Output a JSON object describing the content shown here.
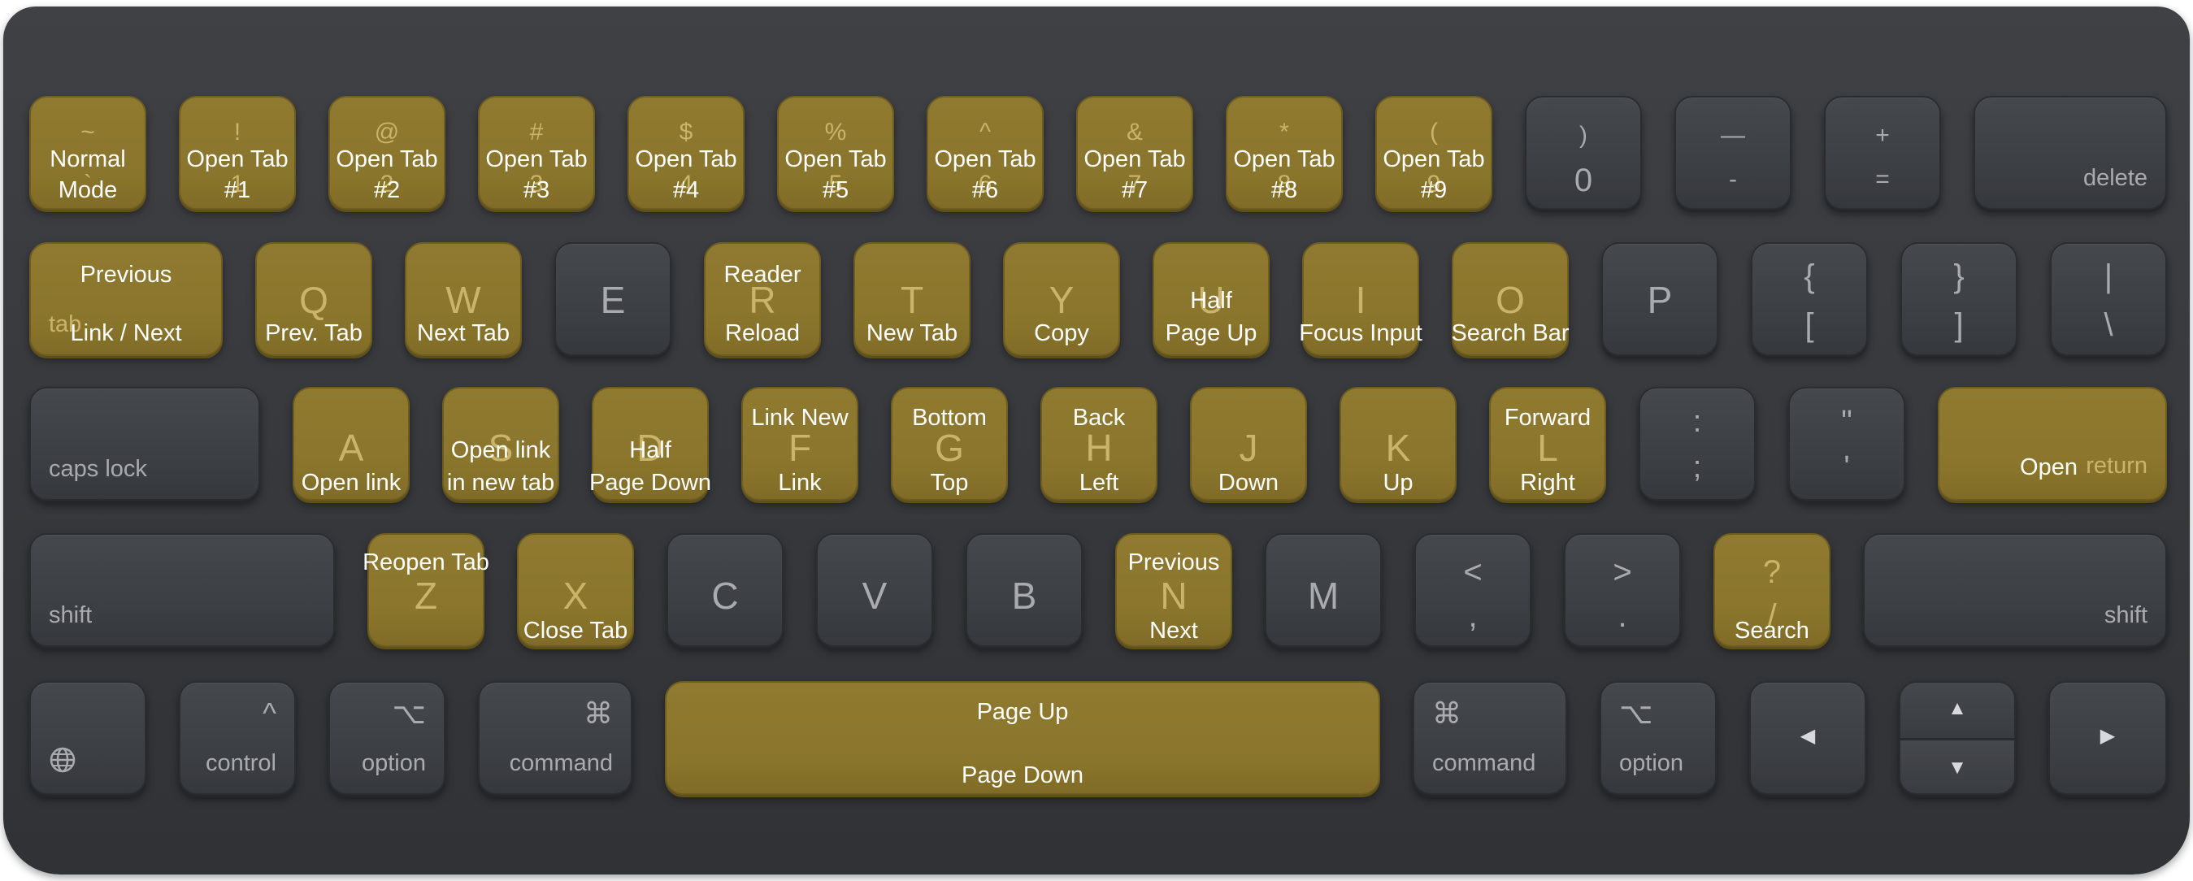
{
  "rows": {
    "numbers": [
      {
        "top": "~",
        "bottom": "`",
        "desc": [
          "Normal",
          "Mode"
        ],
        "hl": true
      },
      {
        "top": "!",
        "bottom": "1",
        "desc": [
          "Open Tab",
          "#1"
        ],
        "hl": true
      },
      {
        "top": "@",
        "bottom": "2",
        "desc": [
          "Open Tab",
          "#2"
        ],
        "hl": true
      },
      {
        "top": "#",
        "bottom": "3",
        "desc": [
          "Open Tab",
          "#3"
        ],
        "hl": true
      },
      {
        "top": "$",
        "bottom": "4",
        "desc": [
          "Open Tab",
          "#4"
        ],
        "hl": true
      },
      {
        "top": "%",
        "bottom": "5",
        "desc": [
          "Open Tab",
          "#5"
        ],
        "hl": true
      },
      {
        "top": "^",
        "bottom": "6",
        "desc": [
          "Open Tab",
          "#6"
        ],
        "hl": true
      },
      {
        "top": "&",
        "bottom": "7",
        "desc": [
          "Open Tab",
          "#7"
        ],
        "hl": true
      },
      {
        "top": "*",
        "bottom": "8",
        "desc": [
          "Open Tab",
          "#8"
        ],
        "hl": true
      },
      {
        "top": "(",
        "bottom": "9",
        "desc": [
          "Open Tab",
          "#9"
        ],
        "hl": true
      },
      {
        "top": ")",
        "bottom": "0",
        "desc": [],
        "hl": false
      },
      {
        "top": "—",
        "bottom": "-",
        "desc": [],
        "hl": false
      },
      {
        "top": "+",
        "bottom": "=",
        "desc": [],
        "hl": false
      },
      {
        "word": "delete",
        "desc": [],
        "hl": false
      }
    ],
    "qwerty": [
      {
        "word": "tab",
        "desc": [
          "Previous",
          "Link / Next"
        ],
        "hl": true
      },
      {
        "letter": "Q",
        "desc": [
          "Prev. Tab"
        ],
        "hl": true
      },
      {
        "letter": "W",
        "desc": [
          "Next Tab"
        ],
        "hl": true
      },
      {
        "letter": "E",
        "desc": [],
        "hl": false
      },
      {
        "letter": "R",
        "desc": [
          "Reader",
          "Reload"
        ],
        "hl": true
      },
      {
        "letter": "T",
        "desc": [
          "New Tab"
        ],
        "hl": true
      },
      {
        "letter": "Y",
        "desc": [
          "Copy"
        ],
        "hl": true
      },
      {
        "letter": "U",
        "desc": [
          "Half",
          "Page Up"
        ],
        "hl": true
      },
      {
        "letter": "I",
        "desc": [
          "Focus Input"
        ],
        "hl": true
      },
      {
        "letter": "O",
        "desc": [
          "Search Bar"
        ],
        "hl": true
      },
      {
        "letter": "P",
        "desc": [],
        "hl": false
      },
      {
        "top": "{",
        "bottom": "[",
        "desc": [],
        "hl": false
      },
      {
        "top": "}",
        "bottom": "]",
        "desc": [],
        "hl": false
      },
      {
        "top": "|",
        "bottom": "\\",
        "desc": [],
        "hl": false
      }
    ],
    "home": [
      {
        "word": "caps lock",
        "desc": [],
        "hl": false
      },
      {
        "letter": "A",
        "desc": [
          "Open link"
        ],
        "hl": true
      },
      {
        "letter": "S",
        "desc": [
          "Open link",
          "in new tab"
        ],
        "hl": true
      },
      {
        "letter": "D",
        "desc": [
          "Half",
          "Page Down"
        ],
        "hl": true
      },
      {
        "letter": "F",
        "desc": [
          "Link New",
          "Link"
        ],
        "hl": true
      },
      {
        "letter": "G",
        "desc": [
          "Bottom",
          "Top"
        ],
        "hl": true
      },
      {
        "letter": "H",
        "desc": [
          "Back",
          "Left"
        ],
        "hl": true
      },
      {
        "letter": "J",
        "desc": [
          "Down"
        ],
        "hl": true
      },
      {
        "letter": "K",
        "desc": [
          "Up"
        ],
        "hl": true
      },
      {
        "letter": "L",
        "desc": [
          "Forward",
          "Right"
        ],
        "hl": true
      },
      {
        "top": ":",
        "bottom": ";",
        "desc": [],
        "hl": false
      },
      {
        "top": "\"",
        "bottom": "'",
        "desc": [],
        "hl": false
      },
      {
        "word": "return",
        "desc": [
          "Open"
        ],
        "hl": true
      }
    ],
    "bottom": [
      {
        "word": "shift",
        "desc": [],
        "hl": false
      },
      {
        "letter": "Z",
        "desc": [
          "Reopen Tab"
        ],
        "hl": true
      },
      {
        "letter": "X",
        "desc": [
          "Close Tab"
        ],
        "hl": true
      },
      {
        "letter": "C",
        "desc": [],
        "hl": false
      },
      {
        "letter": "V",
        "desc": [],
        "hl": false
      },
      {
        "letter": "B",
        "desc": [],
        "hl": false
      },
      {
        "letter": "N",
        "desc": [
          "Previous",
          "Next"
        ],
        "hl": true
      },
      {
        "letter": "M",
        "desc": [],
        "hl": false
      },
      {
        "top": "<",
        "bottom": ",",
        "desc": [],
        "hl": false
      },
      {
        "top": ">",
        "bottom": ".",
        "desc": [],
        "hl": false
      },
      {
        "top": "?",
        "bottom": "/",
        "desc": [
          "Search"
        ],
        "hl": true
      },
      {
        "word": "shift",
        "desc": [],
        "hl": false
      }
    ],
    "space": [
      {
        "icon": "globe-icon",
        "desc": [],
        "hl": false
      },
      {
        "symbol": "^",
        "word": "control",
        "desc": [],
        "hl": false
      },
      {
        "symbol": "⌥",
        "word": "option",
        "desc": [],
        "hl": false
      },
      {
        "symbol": "⌘",
        "word": "command",
        "desc": [],
        "hl": false
      },
      {
        "word": "",
        "desc": [
          "Page Up",
          "Page Down"
        ],
        "hl": true
      },
      {
        "symbol": "⌘",
        "word": "command",
        "desc": [],
        "hl": false
      },
      {
        "symbol": "⌥",
        "word": "option",
        "desc": [],
        "hl": false
      },
      {
        "symbol": "◀",
        "desc": [],
        "hl": false
      },
      {
        "symbol": "▲",
        "symbol2": "▼",
        "desc": [],
        "hl": false
      },
      {
        "symbol": "▶",
        "desc": [],
        "hl": false
      }
    ]
  },
  "colors": {
    "highlight": "#8a752c",
    "key": "#3f4246",
    "board": "#38393c",
    "desc_text": "#ffffff"
  }
}
